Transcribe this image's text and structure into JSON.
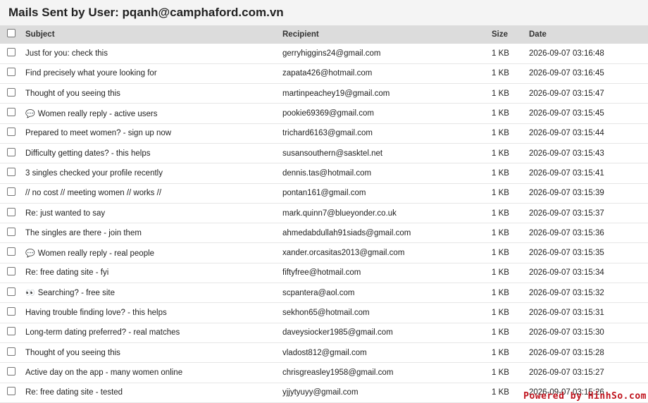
{
  "page": {
    "title": "Mails Sent by User: pqanh@camphaford.com.vn"
  },
  "table": {
    "headers": {
      "subject": "Subject",
      "recipient": "Recipient",
      "size": "Size",
      "date": "Date"
    },
    "rows": [
      {
        "icon": "",
        "subject": "Just for you: check this",
        "recipient": "gerryhiggins24@gmail.com",
        "size": "1 KB",
        "date": "2026-09-07 03:16:48"
      },
      {
        "icon": "",
        "subject": "Find precisely what youre looking for",
        "recipient": "zapata426@hotmail.com",
        "size": "1 KB",
        "date": "2026-09-07 03:16:45"
      },
      {
        "icon": "",
        "subject": "Thought of you seeing this",
        "recipient": "martinpeachey19@gmail.com",
        "size": "1 KB",
        "date": "2026-09-07 03:15:47"
      },
      {
        "icon": "💬",
        "subject": "Women really reply - active users",
        "recipient": "pookie69369@gmail.com",
        "size": "1 KB",
        "date": "2026-09-07 03:15:45"
      },
      {
        "icon": "",
        "subject": "Prepared to meet women? - sign up now",
        "recipient": "trichard6163@gmail.com",
        "size": "1 KB",
        "date": "2026-09-07 03:15:44"
      },
      {
        "icon": "",
        "subject": "Difficulty getting dates? - this helps",
        "recipient": "susansouthern@sasktel.net",
        "size": "1 KB",
        "date": "2026-09-07 03:15:43"
      },
      {
        "icon": "",
        "subject": "3 singles checked your profile recently",
        "recipient": "dennis.tas@hotmail.com",
        "size": "1 KB",
        "date": "2026-09-07 03:15:41"
      },
      {
        "icon": "",
        "subject": "// no cost // meeting women // works //",
        "recipient": "pontan161@gmail.com",
        "size": "1 KB",
        "date": "2026-09-07 03:15:39"
      },
      {
        "icon": "",
        "subject": "Re: just wanted to say",
        "recipient": "mark.quinn7@blueyonder.co.uk",
        "size": "1 KB",
        "date": "2026-09-07 03:15:37"
      },
      {
        "icon": "",
        "subject": "The singles are there - join them",
        "recipient": "ahmedabdullah91siads@gmail.com",
        "size": "1 KB",
        "date": "2026-09-07 03:15:36"
      },
      {
        "icon": "💬",
        "subject": "Women really reply - real people",
        "recipient": "xander.orcasitas2013@gmail.com",
        "size": "1 KB",
        "date": "2026-09-07 03:15:35"
      },
      {
        "icon": "",
        "subject": "Re: free dating site - fyi",
        "recipient": "fiftyfree@hotmail.com",
        "size": "1 KB",
        "date": "2026-09-07 03:15:34"
      },
      {
        "icon": "👀",
        "subject": "Searching? - free site",
        "recipient": "scpantera@aol.com",
        "size": "1 KB",
        "date": "2026-09-07 03:15:32"
      },
      {
        "icon": "",
        "subject": "Having trouble finding love? - this helps",
        "recipient": "sekhon65@hotmail.com",
        "size": "1 KB",
        "date": "2026-09-07 03:15:31"
      },
      {
        "icon": "",
        "subject": "Long-term dating preferred? - real matches",
        "recipient": "daveysiocker1985@gmail.com",
        "size": "1 KB",
        "date": "2026-09-07 03:15:30"
      },
      {
        "icon": "",
        "subject": "Thought of you seeing this",
        "recipient": "vladost812@gmail.com",
        "size": "1 KB",
        "date": "2026-09-07 03:15:28"
      },
      {
        "icon": "",
        "subject": "Active day on the app - many women online",
        "recipient": "chrisgreasley1958@gmail.com",
        "size": "1 KB",
        "date": "2026-09-07 03:15:27"
      },
      {
        "icon": "",
        "subject": "Re: free dating site - tested",
        "recipient": "yjjytyuyy@gmail.com",
        "size": "1 KB",
        "date": "2026-09-07 03:15:26"
      }
    ]
  },
  "watermark": {
    "text": "Powered by HinhSo.com"
  }
}
